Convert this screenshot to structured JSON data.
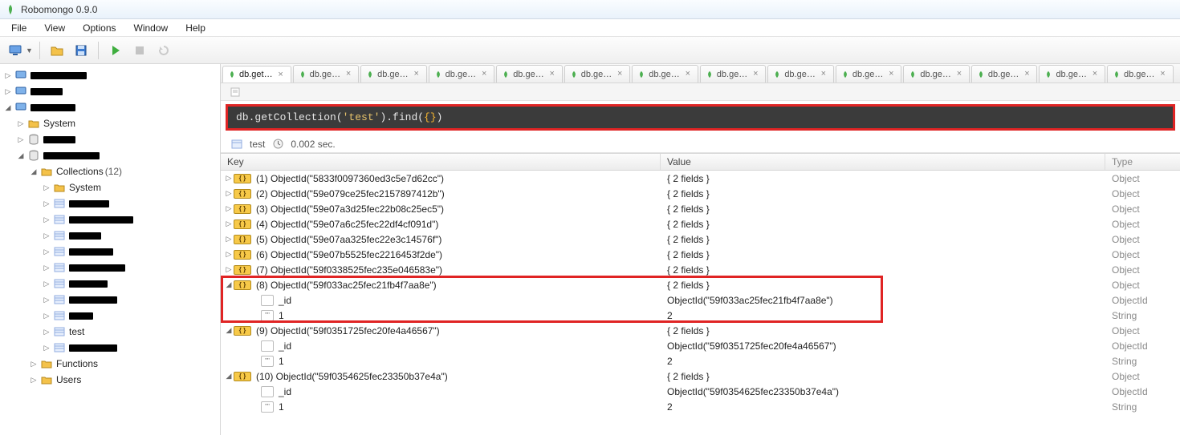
{
  "window": {
    "title": "Robomongo 0.9.0"
  },
  "menu": {
    "items": [
      "File",
      "View",
      "Options",
      "Window",
      "Help"
    ]
  },
  "toolbar": {
    "connect_tip": "Connect",
    "open_tip": "Open",
    "save_tip": "Save",
    "run_tip": "Run",
    "stop_tip": "Stop",
    "refresh_tip": "Refresh"
  },
  "sidebar": {
    "system_label": "System",
    "collections_label": "Collections",
    "collections_count": "(12)",
    "inner_system_label": "System",
    "test_label": "test",
    "functions_label": "Functions",
    "users_label": "Users"
  },
  "tabs": {
    "items": [
      {
        "label": "db.get…",
        "active": true
      },
      {
        "label": "db.ge…"
      },
      {
        "label": "db.ge…"
      },
      {
        "label": "db.ge…"
      },
      {
        "label": "db.ge…"
      },
      {
        "label": "db.ge…"
      },
      {
        "label": "db.ge…"
      },
      {
        "label": "db.ge…"
      },
      {
        "label": "db.ge…"
      },
      {
        "label": "db.ge…"
      },
      {
        "label": "db.ge…"
      },
      {
        "label": "db.ge…"
      },
      {
        "label": "db.ge…"
      },
      {
        "label": "db.ge…"
      }
    ]
  },
  "query": {
    "prefix": "db.getCollection(",
    "arg": "'test'",
    "mid": ").find(",
    "braces": "{}",
    "suffix": ")"
  },
  "status": {
    "collection": "test",
    "time": "0.002 sec."
  },
  "grid": {
    "headers": {
      "key": "Key",
      "value": "Value",
      "type": "Type"
    },
    "twofields": "{ 2 fields }",
    "type_object": "Object",
    "type_objectid": "ObjectId",
    "type_string": "String",
    "field_id": "_id",
    "field_one": "1",
    "val_two": "2",
    "rows": [
      {
        "idx": "(1)",
        "oid": "ObjectId(\"5833f0097360ed3c5e7d62cc\")",
        "expanded": false
      },
      {
        "idx": "(2)",
        "oid": "ObjectId(\"59e079ce25fec2157897412b\")",
        "expanded": false
      },
      {
        "idx": "(3)",
        "oid": "ObjectId(\"59e07a3d25fec22b08c25ec5\")",
        "expanded": false
      },
      {
        "idx": "(4)",
        "oid": "ObjectId(\"59e07a6c25fec22df4cf091d\")",
        "expanded": false
      },
      {
        "idx": "(5)",
        "oid": "ObjectId(\"59e07aa325fec22e3c14576f\")",
        "expanded": false
      },
      {
        "idx": "(6)",
        "oid": "ObjectId(\"59e07b5525fec2216453f2de\")",
        "expanded": false
      },
      {
        "idx": "(7)",
        "oid": "ObjectId(\"59f0338525fec235e046583e\")",
        "expanded": false
      },
      {
        "idx": "(8)",
        "oid": "ObjectId(\"59f033ac25fec21fb4f7aa8e\")",
        "expanded": true,
        "id_val": "ObjectId(\"59f033ac25fec21fb4f7aa8e\")"
      },
      {
        "idx": "(9)",
        "oid": "ObjectId(\"59f0351725fec20fe4a46567\")",
        "expanded": true,
        "id_val": "ObjectId(\"59f0351725fec20fe4a46567\")"
      },
      {
        "idx": "(10)",
        "oid": "ObjectId(\"59f0354625fec23350b37e4a\")",
        "expanded": true,
        "id_val": "ObjectId(\"59f0354625fec23350b37e4a\")"
      }
    ]
  }
}
